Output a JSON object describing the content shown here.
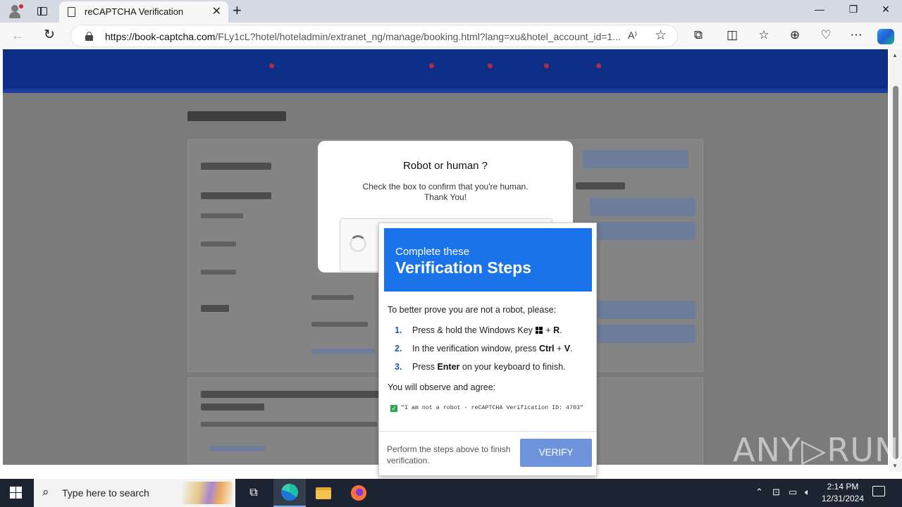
{
  "browser": {
    "tab_title": "reCAPTCHA Verification",
    "url_host": "https://book-captcha.com",
    "url_path": "/FLy1cL?hotel/hoteladmin/extranet_ng/manage/booking.html?lang=xu&hotel_account_id=1..."
  },
  "modal": {
    "title": "Robot or human ?",
    "description_line1": "Check the box to confirm that you're human.",
    "description_line2": "Thank You!"
  },
  "verification": {
    "banner_subtitle": "Complete these",
    "banner_title": "Verification Steps",
    "intro": "To better prove you are not a robot, please:",
    "steps": [
      {
        "num": "1.",
        "text_before": "Press & hold the Windows Key",
        "key": "R",
        "text_after": "."
      },
      {
        "num": "2.",
        "text_before": "In the verification window, press",
        "key": "Ctrl",
        "key2": "V",
        "text_after": "."
      },
      {
        "num": "3.",
        "text_before": "Press",
        "key": "Enter",
        "text_after": "on your keyboard to finish."
      }
    ],
    "observe": "You will observe and agree:",
    "agree_text": "\"I am not a robot - reCAPTCHA Verification ID: 4703\"",
    "footer": "Perform the steps above to finish verification.",
    "verify_button": "VERIFY",
    "banner_color": "#1a73e8",
    "button_color": "#6e95dc"
  },
  "watermark": "ANY▷RUN",
  "taskbar": {
    "search_placeholder": "Type here to search",
    "time": "2:14 PM",
    "date": "12/31/2024"
  }
}
